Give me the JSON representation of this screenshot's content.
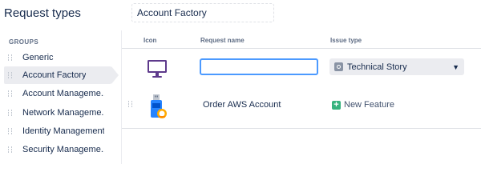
{
  "page": {
    "title": "Request types",
    "current_group": "Account Factory"
  },
  "sidebar": {
    "heading": "GROUPS",
    "items": [
      {
        "label": "Generic"
      },
      {
        "label": "Account Factory",
        "active": true
      },
      {
        "label": "Account Manageme..."
      },
      {
        "label": "Network Manageme..."
      },
      {
        "label": "Identity Management"
      },
      {
        "label": "Security Manageme..."
      }
    ]
  },
  "table": {
    "columns": {
      "icon": "Icon",
      "name": "Request name",
      "issue_type": "Issue type"
    },
    "new_row": {
      "icon": "monitor-icon",
      "name_value": "",
      "issue_type": "Technical Story"
    },
    "rows": [
      {
        "icon": "usb-drive-icon",
        "name": "Order AWS Account",
        "issue_type": "New Feature"
      }
    ]
  },
  "colors": {
    "focus_border": "#4c9aff",
    "new_feature": "#36b37e",
    "active_bg": "#ebecf0"
  }
}
